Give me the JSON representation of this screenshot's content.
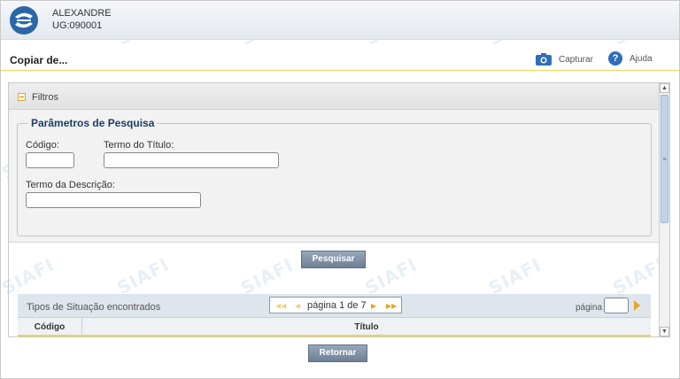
{
  "header": {
    "user_name": "ALEXANDRE",
    "user_ug": "UG:090001",
    "logo_icon": "siafi-logo-icon",
    "watermark_text": "SIAFI"
  },
  "titlebar": {
    "title": "Copiar de...",
    "capturar_label": "Capturar",
    "capturar_icon": "camera-icon",
    "ajuda_label": "Ajuda",
    "ajuda_icon": "help-icon",
    "ajuda_glyph": "?"
  },
  "filtros": {
    "section_label": "Filtros",
    "legend": "Parâmetros de Pesquisa",
    "codigo_label": "Código:",
    "codigo_value": "",
    "titulo_label": "Termo do Título:",
    "titulo_value": "",
    "descricao_label": "Termo da Descrição:",
    "descricao_value": ""
  },
  "actions": {
    "pesquisar_label": "Pesquisar",
    "retornar_label": "Retornar"
  },
  "results": {
    "title": "Tipos de Situação encontrados",
    "pager_text": "página 1 de 7",
    "page_label": "página",
    "page_value": "",
    "columns": [
      "Código",
      "Título"
    ]
  },
  "colors": {
    "accent_yellow": "#f0d35a",
    "brand_blue": "#2a66a8",
    "button_gray_blue": "#7f8fa4"
  }
}
